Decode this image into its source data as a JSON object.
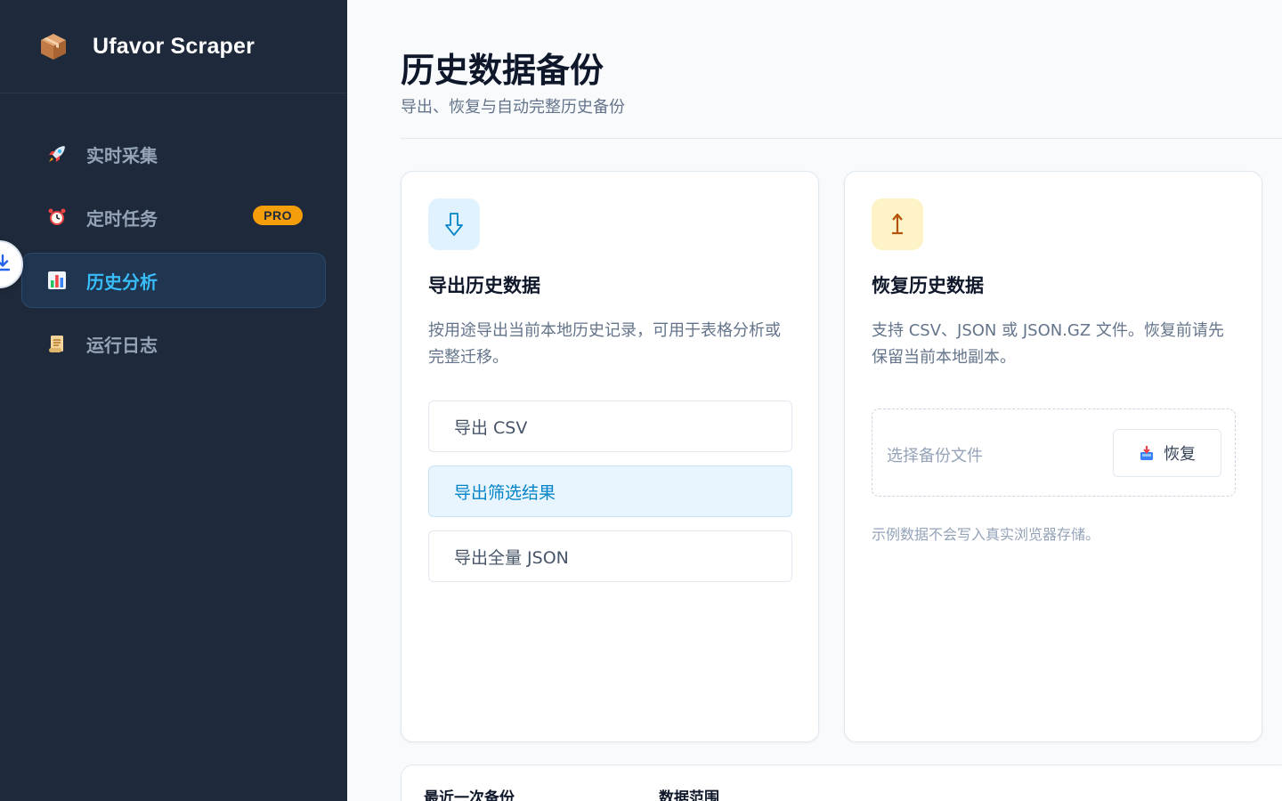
{
  "app": {
    "title": "Ufavor Scraper",
    "logo_icon": "package-box-icon"
  },
  "sidebar": {
    "items": [
      {
        "label": "实时采集",
        "icon": "rocket-icon",
        "active": false
      },
      {
        "label": "定时任务",
        "icon": "alarm-clock-icon",
        "badge": "PRO",
        "active": false
      },
      {
        "label": "历史分析",
        "icon": "bar-chart-icon",
        "active": true
      },
      {
        "label": "运行日志",
        "icon": "scroll-icon",
        "active": false
      }
    ]
  },
  "floating_button": {
    "icon": "download-icon"
  },
  "page": {
    "title": "历史数据备份",
    "subtitle": "导出、恢复与自动完整历史备份"
  },
  "export_card": {
    "icon": "arrow-down-icon",
    "title": "导出历史数据",
    "description": "按用途导出当前本地历史记录，可用于表格分析或完整迁移。",
    "buttons": [
      {
        "label": "导出 CSV"
      },
      {
        "label": "导出筛选结果",
        "highlighted": true
      },
      {
        "label": "导出全量 JSON"
      }
    ]
  },
  "restore_card": {
    "icon": "arrow-up-down-icon",
    "title": "恢复历史数据",
    "description": "支持 CSV、JSON 或 JSON.GZ 文件。恢复前请先保留当前本地副本。",
    "file_placeholder": "选择备份文件",
    "restore_button": "恢复",
    "restore_icon": "inbox-tray-icon",
    "note": "示例数据不会写入真实浏览器存储。"
  },
  "summary": {
    "last_backup_label": "最近一次备份",
    "data_range_label": "数据范围"
  },
  "colors": {
    "sidebar_bg": "#1e293b",
    "accent": "#38bdf8",
    "pro_badge": "#f59e0b",
    "page_bg": "#f8fafc"
  }
}
